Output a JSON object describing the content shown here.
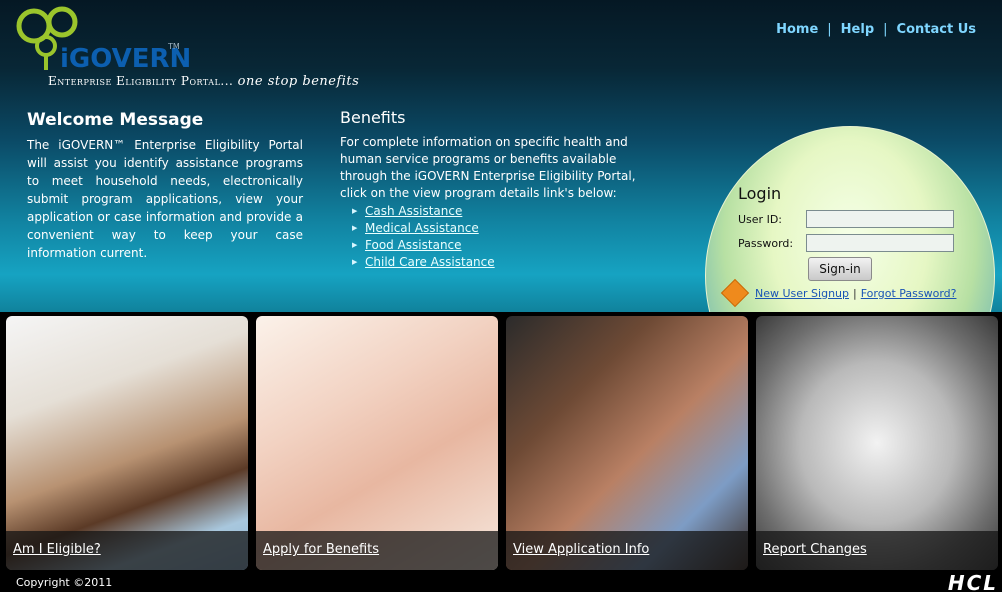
{
  "brand": {
    "name": "iGOVERN",
    "tm": "TM",
    "tagline": "Enterprise Eligibility Portal...",
    "tagline_italic": "one stop benefits"
  },
  "topnav": {
    "home": "Home",
    "help": "Help",
    "contact": "Contact Us",
    "sep": "|"
  },
  "welcome": {
    "title": "Welcome Message",
    "body": "The iGOVERN™ Enterprise Eligibility Portal will assist you identify assistance programs to meet household needs, electronically submit program applications, view your application or case information and provide a convenient way to keep your case information current."
  },
  "benefits": {
    "title": "Benefits",
    "intro": "For complete information on specific health and human service programs or benefits available through the iGOVERN Enterprise Eligibility Portal, click on the view program details link's below:",
    "links": [
      "Cash Assistance",
      "Medical Assistance",
      "Food Assistance",
      "Child Care Assistance"
    ]
  },
  "login": {
    "title": "Login",
    "userid_label": "User ID:",
    "password_label": "Password:",
    "userid_value": "",
    "password_value": "",
    "signin": "Sign-in",
    "new_user": "New User Signup",
    "sep": "|",
    "forgot": "Forgot Password?"
  },
  "cards": [
    {
      "label": "Am I Eligible?",
      "image": "doctor-patient-photo"
    },
    {
      "label": "Apply for Benefits",
      "image": "holding-hands-photo"
    },
    {
      "label": "View Application Info",
      "image": "two-women-photo"
    },
    {
      "label": "Report Changes",
      "image": "paper-family-hands-photo"
    }
  ],
  "footer": {
    "copyright": "Copyright ©2011",
    "partner_logo": "HCL"
  },
  "colors": {
    "nav_link": "#7fd6ff",
    "brand_blue": "#0c5fb0",
    "logo_green": "#9bc52c",
    "login_link": "#1a55b5"
  }
}
